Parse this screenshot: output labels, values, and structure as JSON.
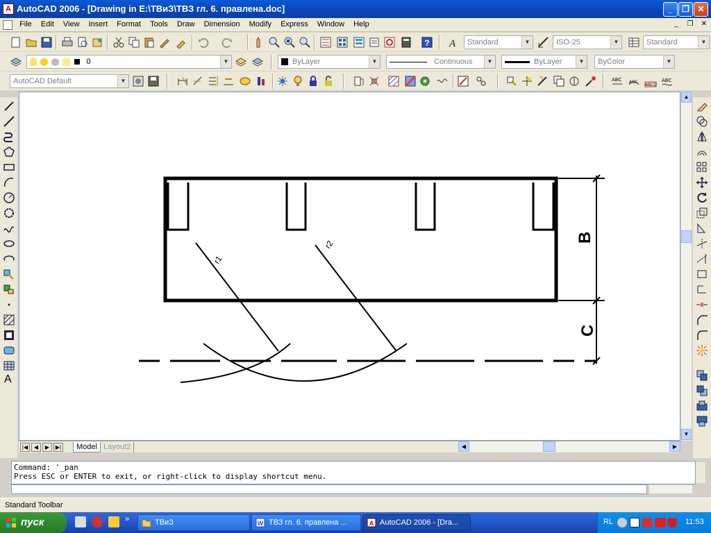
{
  "window": {
    "title": "AutoCAD 2006 - [Drawing in E:\\ТВиЗ\\ТВЗ гл. 6. правлена.doc]",
    "app_icon": "A",
    "minimize": "_",
    "maximize": "❐",
    "close": "✕"
  },
  "menu": {
    "items": [
      "File",
      "Edit",
      "View",
      "Insert",
      "Format",
      "Tools",
      "Draw",
      "Dimension",
      "Modify",
      "Express",
      "Window",
      "Help"
    ],
    "mdi": [
      "_",
      "❐",
      "✕"
    ]
  },
  "toolbar1": {
    "text_style": "Standard",
    "dim_style": "ISO-25",
    "table_style": "Standard"
  },
  "toolbar2": {
    "layer": "0",
    "color": "ByLayer",
    "linetype": "Continuous",
    "lineweight": "ByLayer",
    "plotstyle": "ByColor"
  },
  "toolbar3": {
    "workspace": "AutoCAD Default"
  },
  "drawing": {
    "label_b": "B",
    "label_c": "C",
    "label_r1": "r1",
    "label_r2": "r2"
  },
  "tabs": {
    "model": "Model",
    "layout2": "Layout2"
  },
  "command": {
    "line1": "Command: '_pan",
    "line2": "Press ESC or ENTER to exit, or right-click to display shortcut menu."
  },
  "status": {
    "text": "Standard Toolbar"
  },
  "taskbar": {
    "start": "пуск",
    "tasks": [
      "ТВиЗ",
      "ТВЗ гл. 6. правлена ...",
      "AutoCAD 2006 - [Dra..."
    ],
    "lang": "RL",
    "clock": "11:53"
  },
  "colors": {
    "titlebar": "#0b46b8",
    "taskbar": "#245bd2",
    "start": "#2f8a2e"
  }
}
